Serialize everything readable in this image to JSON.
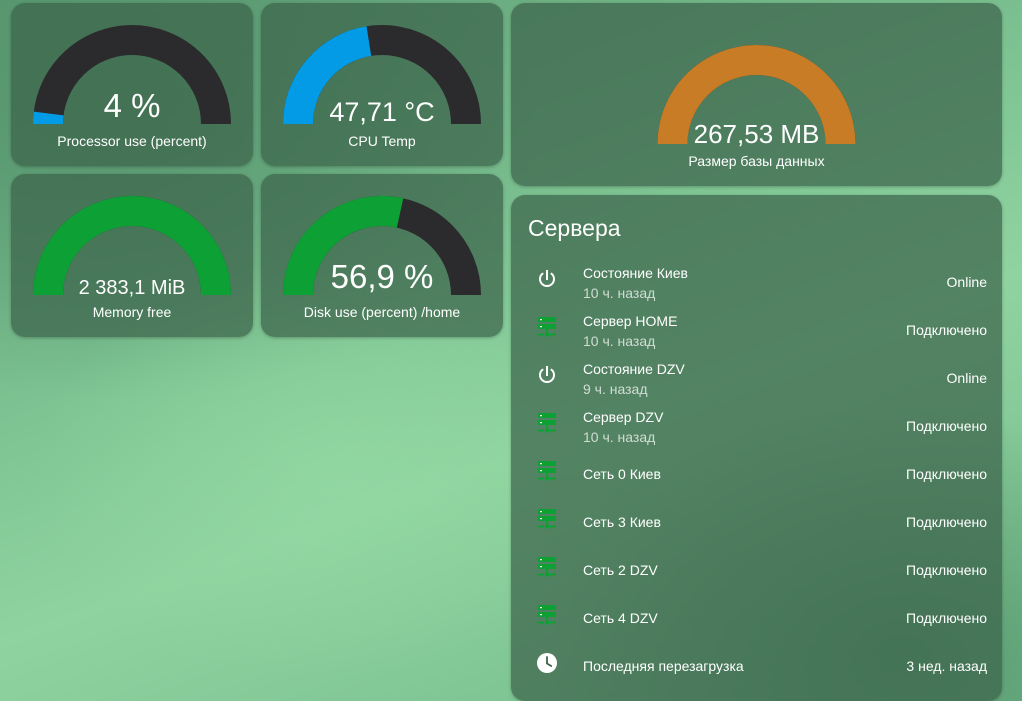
{
  "gauges": {
    "processor": {
      "value": "4 %",
      "name": "Processor use (percent)",
      "fraction": 0.04,
      "color": "#039be5"
    },
    "cpu_temp": {
      "value": "47,71 °C",
      "name": "CPU Temp",
      "fraction": 0.45,
      "color": "#039be5"
    },
    "memory": {
      "value": "2 383,1 MiB",
      "name": "Memory free",
      "fraction": 1.0,
      "color": "#0da035"
    },
    "disk": {
      "value": "56,9 %",
      "name": "Disk use (percent) /home",
      "fraction": 0.569,
      "color": "#0da035"
    },
    "db_size": {
      "value": "267,53 MB",
      "name": "Размер базы данных",
      "fraction": 1.0,
      "color": "#c87c25"
    }
  },
  "colors": {
    "gauge_background": "#2b2a2d",
    "server_icon": "#0da035"
  },
  "servers": {
    "title": "Сервера",
    "rows": [
      {
        "icon": "power-icon",
        "name": "Состояние Киев",
        "sub": "10 ч. назад",
        "state": "Online"
      },
      {
        "icon": "server-icon",
        "name": "Сервер HOME",
        "sub": "10 ч. назад",
        "state": "Подключено"
      },
      {
        "icon": "power-icon",
        "name": "Состояние DZV",
        "sub": "9 ч. назад",
        "state": "Online"
      },
      {
        "icon": "server-icon",
        "name": "Сервер DZV",
        "sub": "10 ч. назад",
        "state": "Подключено"
      },
      {
        "icon": "server-icon",
        "name": "Сеть 0 Киев",
        "sub": "",
        "state": "Подключено"
      },
      {
        "icon": "server-icon",
        "name": "Сеть 3 Киев",
        "sub": "",
        "state": "Подключено"
      },
      {
        "icon": "server-icon",
        "name": "Сеть 2 DZV",
        "sub": "",
        "state": "Подключено"
      },
      {
        "icon": "server-icon",
        "name": "Сеть 4 DZV",
        "sub": "",
        "state": "Подключено"
      },
      {
        "icon": "clock-icon",
        "name": "Последняя перезагрузка",
        "sub": "",
        "state": "3 нед. назад"
      }
    ]
  }
}
